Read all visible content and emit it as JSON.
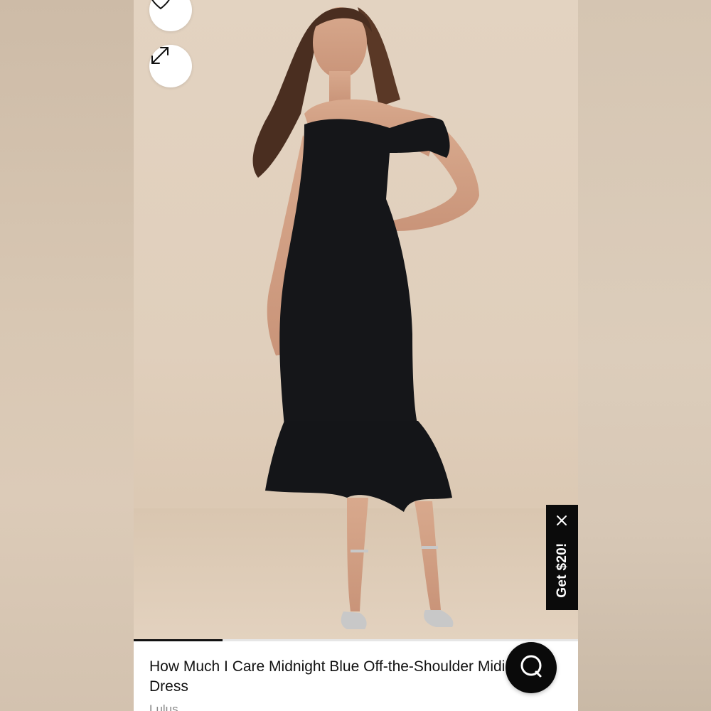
{
  "product": {
    "title": "How Much I Care Midnight Blue Off-the-Shoulder Midi Dress",
    "brand": "Lulus"
  },
  "promo": {
    "label": "Get $20!",
    "close_icon": "close-icon"
  },
  "actions": {
    "wishlist_icon": "heart-icon",
    "expand_icon": "expand-icon",
    "chat_icon": "chat-icon"
  },
  "carousel": {
    "current_image": 1,
    "progress": 0.2
  },
  "colors": {
    "accent": "#0b0b0b",
    "background": "#e0cfbc",
    "text": "#111111"
  }
}
